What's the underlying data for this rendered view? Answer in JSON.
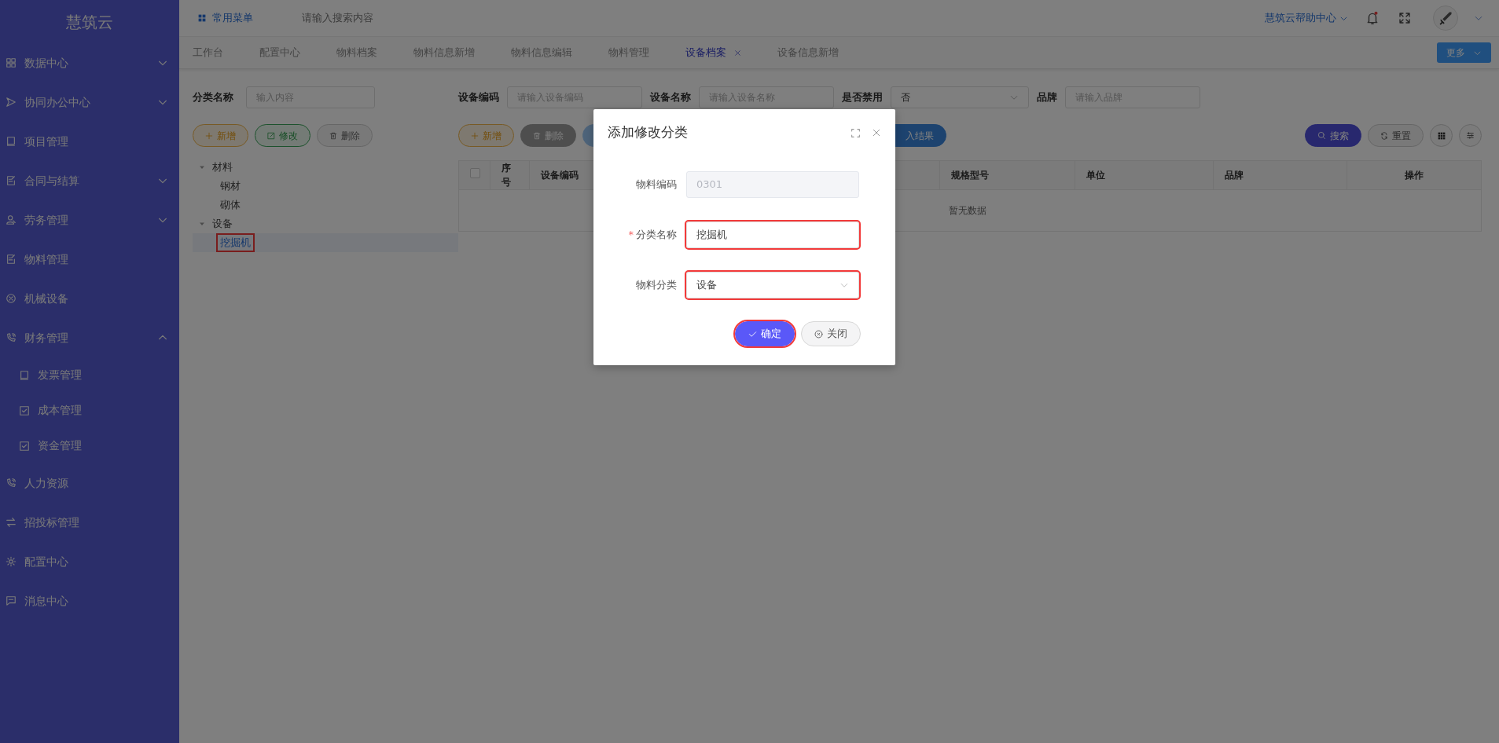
{
  "sidebar": {
    "logo": "慧筑云",
    "items": [
      {
        "label": "数据中心",
        "kind": "group",
        "expanded": false
      },
      {
        "label": "协同办公中心",
        "kind": "group",
        "expanded": false
      },
      {
        "label": "项目管理",
        "kind": "link"
      },
      {
        "label": "合同与结算",
        "kind": "group",
        "expanded": false
      },
      {
        "label": "劳务管理",
        "kind": "group",
        "expanded": false
      },
      {
        "label": "物料管理",
        "kind": "link"
      },
      {
        "label": "机械设备",
        "kind": "link"
      },
      {
        "label": "财务管理",
        "kind": "group",
        "expanded": true,
        "children": [
          {
            "label": "发票管理"
          },
          {
            "label": "成本管理"
          },
          {
            "label": "资金管理"
          }
        ]
      },
      {
        "label": "人力资源",
        "kind": "link"
      },
      {
        "label": "招投标管理",
        "kind": "link"
      },
      {
        "label": "配置中心",
        "kind": "link"
      },
      {
        "label": "消息中心",
        "kind": "link"
      }
    ]
  },
  "header": {
    "menu_label": "常用菜单",
    "search": {
      "placeholder": "请输入搜索内容"
    },
    "help_label": "慧筑云帮助中心",
    "has_unread": true
  },
  "tabs": [
    {
      "label": "工作台",
      "selected": false
    },
    {
      "label": "配置中心",
      "selected": false
    },
    {
      "label": "物料档案",
      "selected": false
    },
    {
      "label": "物料信息新增",
      "selected": false
    },
    {
      "label": "物料信息编辑",
      "selected": false
    },
    {
      "label": "物料管理",
      "selected": false
    },
    {
      "label": "设备档案",
      "selected": true
    },
    {
      "label": "设备信息新增",
      "selected": false
    }
  ],
  "more_button": "更多",
  "category_panel": {
    "filter_label": "分类名称",
    "filter": {
      "placeholder": "输入内容"
    },
    "buttons": [
      {
        "label": "新增",
        "kind": "add"
      },
      {
        "label": "修改",
        "kind": "edit"
      },
      {
        "label": "删除",
        "kind": "delete"
      }
    ],
    "tree": [
      {
        "label": "材料",
        "expanded": true,
        "selected": false,
        "highlighted": false,
        "children": [
          {
            "label": "钢材",
            "selected": false,
            "highlighted": false
          },
          {
            "label": "砌体",
            "selected": false,
            "highlighted": false
          }
        ]
      },
      {
        "label": "设备",
        "expanded": true,
        "selected": false,
        "highlighted": false,
        "children": [
          {
            "label": "挖掘机",
            "selected": true,
            "highlighted": true
          }
        ]
      }
    ]
  },
  "filters": [
    {
      "label": "设备编码",
      "kind": "input",
      "placeholder": "请输入设备编码"
    },
    {
      "label": "设备名称",
      "kind": "input",
      "placeholder": "请输入设备名称"
    },
    {
      "label": "是否禁用",
      "kind": "select",
      "value": "否"
    },
    {
      "label": "品牌",
      "kind": "input",
      "placeholder": "请输入品牌"
    }
  ],
  "toolbar": {
    "left": [
      {
        "label": "新增",
        "kind": "add"
      },
      {
        "label": "删除",
        "kind": "delete"
      },
      {
        "kind": "info"
      },
      {
        "label": "入结果",
        "kind": "import"
      }
    ],
    "right": [
      {
        "label": "搜索",
        "kind": "search"
      },
      {
        "label": "重置",
        "kind": "reset"
      }
    ]
  },
  "table": {
    "columns": [
      {
        "kind": "checkbox",
        "checked": false
      },
      {
        "label": "序号"
      },
      {
        "label": "设备编码"
      },
      {
        "label": "规格型号"
      },
      {
        "label": "单位"
      },
      {
        "label": "品牌"
      },
      {
        "label": "操作"
      }
    ],
    "empty_text": "暂无数据"
  },
  "dialog": {
    "title": "添加修改分类",
    "fields": [
      {
        "label": "物料编码",
        "kind": "input",
        "value": "0301",
        "disabled": true,
        "highlighted": false
      },
      {
        "label": "分类名称",
        "kind": "input",
        "value": "挖掘机",
        "required_mark": "*",
        "disabled": false,
        "highlighted": true
      },
      {
        "label": "物料分类",
        "kind": "select",
        "value": "设备",
        "disabled": false,
        "highlighted": true
      }
    ],
    "buttons": [
      {
        "label": "确定",
        "kind": "primary",
        "highlighted": true
      },
      {
        "label": "关闭",
        "kind": "close",
        "highlighted": false
      }
    ]
  }
}
